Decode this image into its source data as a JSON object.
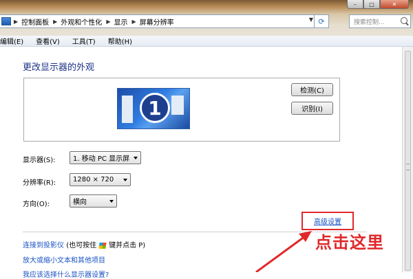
{
  "window": {
    "caption_buttons": [
      "–",
      "□",
      "✕"
    ]
  },
  "address": {
    "crumbs": [
      "控制面板",
      "外观和个性化",
      "显示",
      "屏幕分辨率"
    ],
    "search_placeholder": "搜索控制..."
  },
  "menu": [
    "编辑(E)",
    "查看(V)",
    "工具(T)",
    "帮助(H)"
  ],
  "page": {
    "title": "更改显示器的外观",
    "monitor_number": "1",
    "detect_button": "检测(C)",
    "identify_button": "识别(I)"
  },
  "settings": {
    "display_label": "显示器(S):",
    "display_value": "1. 移动 PC 显示屏",
    "resolution_label": "分辨率(R):",
    "resolution_value": "1280 × 720",
    "orientation_label": "方向(O):",
    "orientation_value": "横向"
  },
  "advanced_link": "高级设置",
  "links": {
    "projector": "连接到投影仪",
    "projector_hint_pre": "(也可按住",
    "projector_hint_post": "键并点击 P)",
    "text_size": "放大或缩小文本和其他项目",
    "partial": "我应该选择什么显示器设置?"
  },
  "annotation": {
    "text": "点击这里",
    "color": "#e0282a"
  }
}
